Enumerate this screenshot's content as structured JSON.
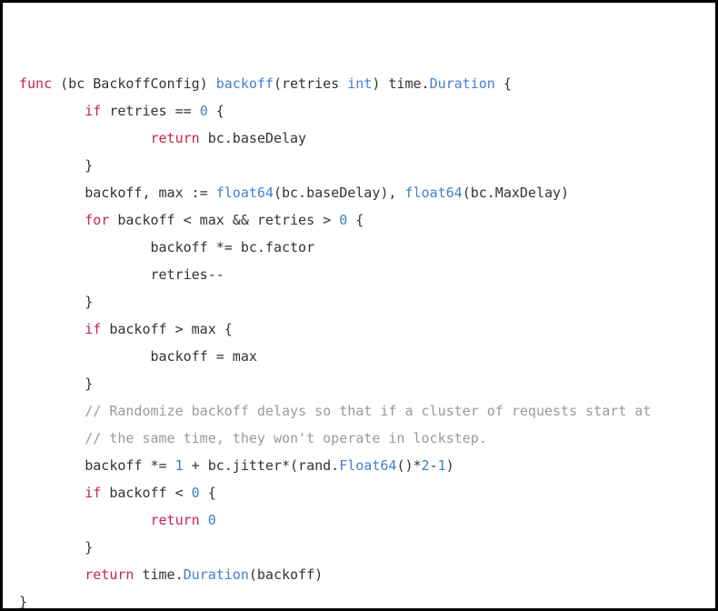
{
  "code": {
    "lines": [
      {
        "indent": 0,
        "tokens": [
          {
            "t": "func ",
            "c": "kw"
          },
          {
            "t": "(bc BackoffConfig) ",
            "c": "id"
          },
          {
            "t": "backoff",
            "c": "typ"
          },
          {
            "t": "(retries ",
            "c": "id"
          },
          {
            "t": "int",
            "c": "typ"
          },
          {
            "t": ") time.",
            "c": "id"
          },
          {
            "t": "Duration",
            "c": "typ"
          },
          {
            "t": " {",
            "c": "id"
          }
        ]
      },
      {
        "indent": 2,
        "tokens": [
          {
            "t": "if ",
            "c": "kw"
          },
          {
            "t": "retries == ",
            "c": "id"
          },
          {
            "t": "0",
            "c": "num"
          },
          {
            "t": " {",
            "c": "id"
          }
        ]
      },
      {
        "indent": 4,
        "tokens": [
          {
            "t": "return ",
            "c": "kw"
          },
          {
            "t": "bc.baseDelay",
            "c": "id"
          }
        ]
      },
      {
        "indent": 2,
        "tokens": [
          {
            "t": "}",
            "c": "id"
          }
        ]
      },
      {
        "indent": 2,
        "tokens": [
          {
            "t": "backoff, max := ",
            "c": "id"
          },
          {
            "t": "float64",
            "c": "typ"
          },
          {
            "t": "(bc.baseDelay), ",
            "c": "id"
          },
          {
            "t": "float64",
            "c": "typ"
          },
          {
            "t": "(bc.MaxDelay)",
            "c": "id"
          }
        ]
      },
      {
        "indent": 2,
        "tokens": [
          {
            "t": "for ",
            "c": "kw"
          },
          {
            "t": "backoff < max && retries > ",
            "c": "id"
          },
          {
            "t": "0",
            "c": "num"
          },
          {
            "t": " {",
            "c": "id"
          }
        ]
      },
      {
        "indent": 4,
        "tokens": [
          {
            "t": "backoff *= bc.factor",
            "c": "id"
          }
        ]
      },
      {
        "indent": 4,
        "tokens": [
          {
            "t": "retries--",
            "c": "id"
          }
        ]
      },
      {
        "indent": 2,
        "tokens": [
          {
            "t": "}",
            "c": "id"
          }
        ]
      },
      {
        "indent": 2,
        "tokens": [
          {
            "t": "if ",
            "c": "kw"
          },
          {
            "t": "backoff > max {",
            "c": "id"
          }
        ]
      },
      {
        "indent": 4,
        "tokens": [
          {
            "t": "backoff = max",
            "c": "id"
          }
        ]
      },
      {
        "indent": 2,
        "tokens": [
          {
            "t": "}",
            "c": "id"
          }
        ]
      },
      {
        "indent": 2,
        "tokens": [
          {
            "t": "// Randomize backoff delays so that if a cluster of requests start at",
            "c": "cmt"
          }
        ]
      },
      {
        "indent": 2,
        "tokens": [
          {
            "t": "// the same time, they won't operate in lockstep.",
            "c": "cmt"
          }
        ]
      },
      {
        "indent": 2,
        "tokens": [
          {
            "t": "backoff *= ",
            "c": "id"
          },
          {
            "t": "1",
            "c": "num"
          },
          {
            "t": " + bc.jitter*(rand.",
            "c": "id"
          },
          {
            "t": "Float64",
            "c": "typ"
          },
          {
            "t": "()*",
            "c": "id"
          },
          {
            "t": "2",
            "c": "num"
          },
          {
            "t": "-",
            "c": "id"
          },
          {
            "t": "1",
            "c": "num"
          },
          {
            "t": ")",
            "c": "id"
          }
        ]
      },
      {
        "indent": 2,
        "tokens": [
          {
            "t": "if ",
            "c": "kw"
          },
          {
            "t": "backoff < ",
            "c": "id"
          },
          {
            "t": "0",
            "c": "num"
          },
          {
            "t": " {",
            "c": "id"
          }
        ]
      },
      {
        "indent": 4,
        "tokens": [
          {
            "t": "return ",
            "c": "kw"
          },
          {
            "t": "0",
            "c": "num"
          }
        ]
      },
      {
        "indent": 2,
        "tokens": [
          {
            "t": "}",
            "c": "id"
          }
        ]
      },
      {
        "indent": 2,
        "tokens": [
          {
            "t": "return ",
            "c": "kw"
          },
          {
            "t": "time.",
            "c": "id"
          },
          {
            "t": "Duration",
            "c": "typ"
          },
          {
            "t": "(backoff)",
            "c": "id"
          }
        ]
      },
      {
        "indent": 0,
        "tokens": [
          {
            "t": "}",
            "c": "id"
          }
        ]
      }
    ]
  },
  "indent_unit": "    "
}
